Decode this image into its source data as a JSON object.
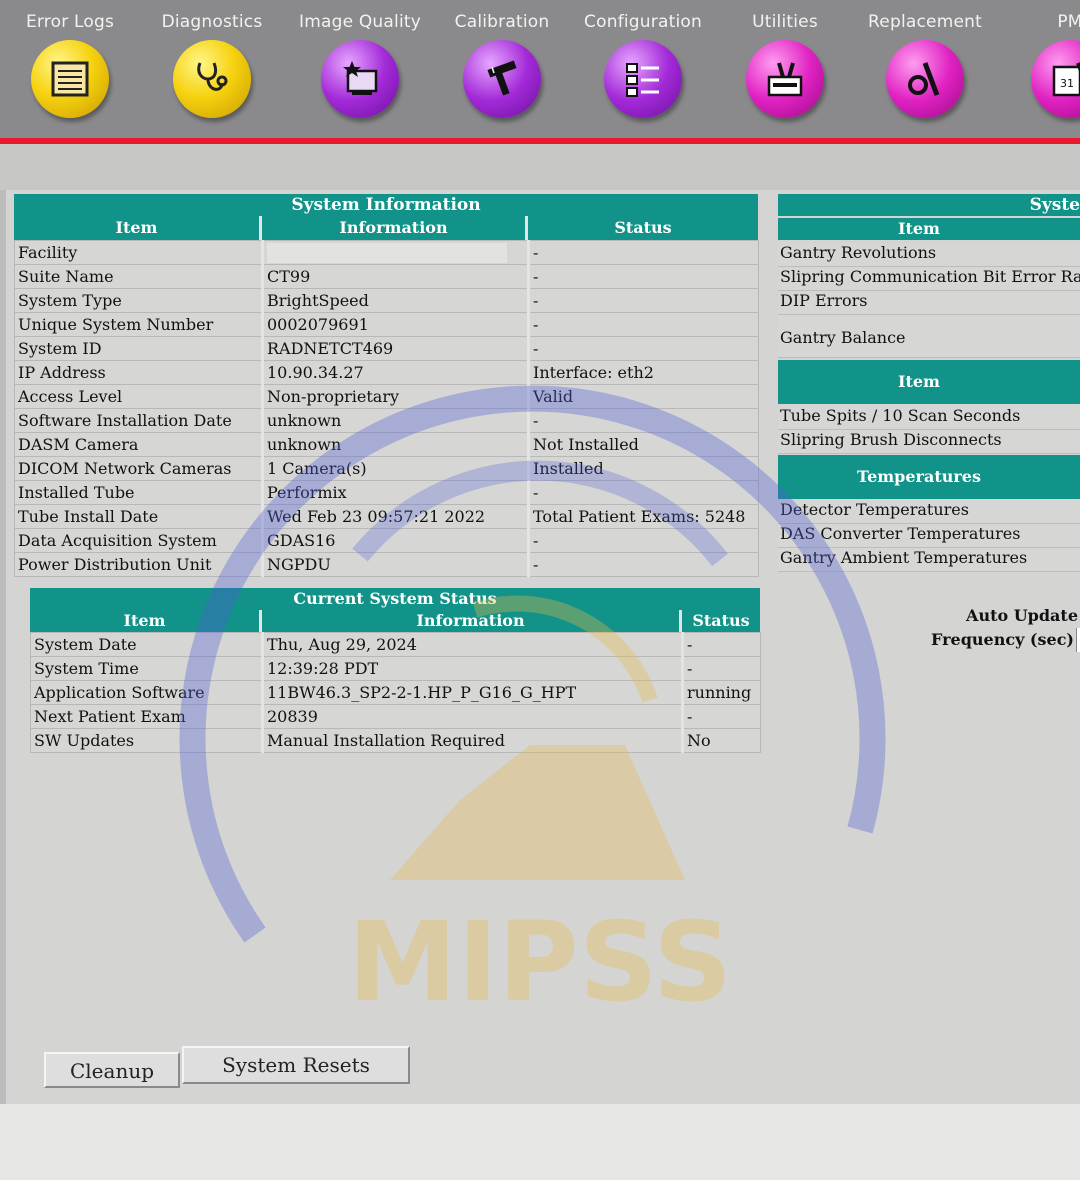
{
  "toolbar": {
    "items": [
      {
        "label": "Error Logs",
        "icon": "error-log-icon",
        "color": "#f6d20f"
      },
      {
        "label": "Diagnostics",
        "icon": "stethoscope-icon",
        "color": "#f6d20f"
      },
      {
        "label": "Image Quality",
        "icon": "monitor-star-icon",
        "color": "#a32ad8"
      },
      {
        "label": "Calibration",
        "icon": "caliper-icon",
        "color": "#a32ad8"
      },
      {
        "label": "Configuration",
        "icon": "checklist-icon",
        "color": "#a32ad8"
      },
      {
        "label": "Utilities",
        "icon": "toolbox-icon",
        "color": "#e022c2"
      },
      {
        "label": "Replacement",
        "icon": "wrench-part-icon",
        "color": "#e022c2"
      },
      {
        "label": "PM",
        "icon": "calendar-tool-icon",
        "color": "#e022c2"
      }
    ],
    "accent_line_color": "#e8192c"
  },
  "system_information": {
    "title": "System Information",
    "headers": {
      "item": "Item",
      "information": "Information",
      "status": "Status"
    },
    "rows": [
      {
        "item": "Facility",
        "information": "",
        "status": "-"
      },
      {
        "item": "Suite Name",
        "information": "CT99",
        "status": "-"
      },
      {
        "item": "System Type",
        "information": "BrightSpeed",
        "status": "-"
      },
      {
        "item": "Unique System Number",
        "information": "0002079691",
        "status": "-"
      },
      {
        "item": "System ID",
        "information": "RADNETCT469",
        "status": "-"
      },
      {
        "item": "IP Address",
        "information": "10.90.34.27",
        "status": "Interface: eth2"
      },
      {
        "item": "Access Level",
        "information": "Non-proprietary",
        "status": "Valid"
      },
      {
        "item": "Software Installation Date",
        "information": "unknown",
        "status": "-"
      },
      {
        "item": "DASM Camera",
        "information": "unknown",
        "status": "Not Installed"
      },
      {
        "item": "DICOM Network Cameras",
        "information": "1 Camera(s)",
        "status": "Installed"
      },
      {
        "item": "Installed Tube",
        "information": "Performix",
        "status": "-"
      },
      {
        "item": "Tube Install Date",
        "information": "Wed Feb 23 09:57:21 2022",
        "status": "Total Patient Exams: 5248"
      },
      {
        "item": "Data Acquisition System",
        "information": "GDAS16",
        "status": "-"
      },
      {
        "item": "Power Distribution Unit",
        "information": "NGPDU",
        "status": "-"
      }
    ]
  },
  "current_status": {
    "title": "Current System Status",
    "headers": {
      "item": "Item",
      "information": "Information",
      "status": "Status"
    },
    "rows": [
      {
        "item": "System Date",
        "information": "Thu, Aug 29, 2024",
        "status": "-"
      },
      {
        "item": "System Time",
        "information": "12:39:28 PDT",
        "status": "-"
      },
      {
        "item": "Application Software",
        "information": "11BW46.3_SP2-2-1.HP_P_G16_G_HPT",
        "status": "running"
      },
      {
        "item": "Next Patient Exam",
        "information": "20839",
        "status": "-"
      },
      {
        "item": "SW Updates",
        "information": "Manual Installation Required",
        "status": "No"
      }
    ]
  },
  "system_counters": {
    "title": "Syste",
    "header_item": "Item",
    "rows_a": [
      "Gantry Revolutions",
      "Slipring Communication Bit Error Rate",
      "DIP Errors",
      "Gantry Balance"
    ],
    "header_item_2": "Item",
    "rows_b": [
      "Tube Spits / 10 Scan Seconds",
      "Slipring Brush Disconnects"
    ],
    "header_temps": "Temperatures",
    "rows_c": [
      "Detector Temperatures",
      "DAS Converter Temperatures",
      "Gantry Ambient Temperatures"
    ],
    "auto_update_label": "Auto Update",
    "frequency_label": "Frequency (sec)"
  },
  "buttons": {
    "cleanup": "Cleanup",
    "resets": "System Resets"
  },
  "watermark": {
    "text": "MIPSS"
  }
}
